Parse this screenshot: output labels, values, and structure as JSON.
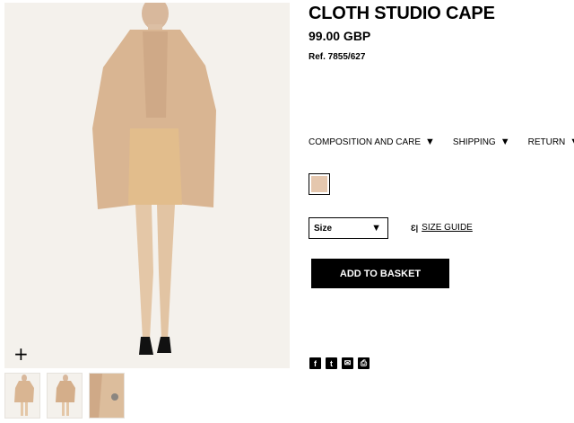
{
  "product": {
    "title": "CLOTH STUDIO CAPE",
    "price": "99.00 GBP",
    "ref": "Ref. 7855/627"
  },
  "info_tabs": [
    {
      "label": "COMPOSITION AND CARE"
    },
    {
      "label": "SHIPPING"
    },
    {
      "label": "RETURN"
    }
  ],
  "colors": {
    "swatch": "#e5c7ae",
    "cape": "#d9b592",
    "button_bg": "#000000"
  },
  "size": {
    "selected": "Size",
    "guide_label": "SIZE GUIDE"
  },
  "actions": {
    "add_to_basket": "ADD TO BASKET"
  },
  "icons": {
    "zoom": "plus-icon",
    "share": [
      "facebook-icon",
      "twitter-icon",
      "email-icon",
      "print-icon"
    ]
  },
  "glyphs": {
    "zoom": "+",
    "dropdown": "▼",
    "size_guide": "Ɛ|",
    "facebook": "f",
    "twitter": "t",
    "email": "✉",
    "print": "⎙"
  }
}
